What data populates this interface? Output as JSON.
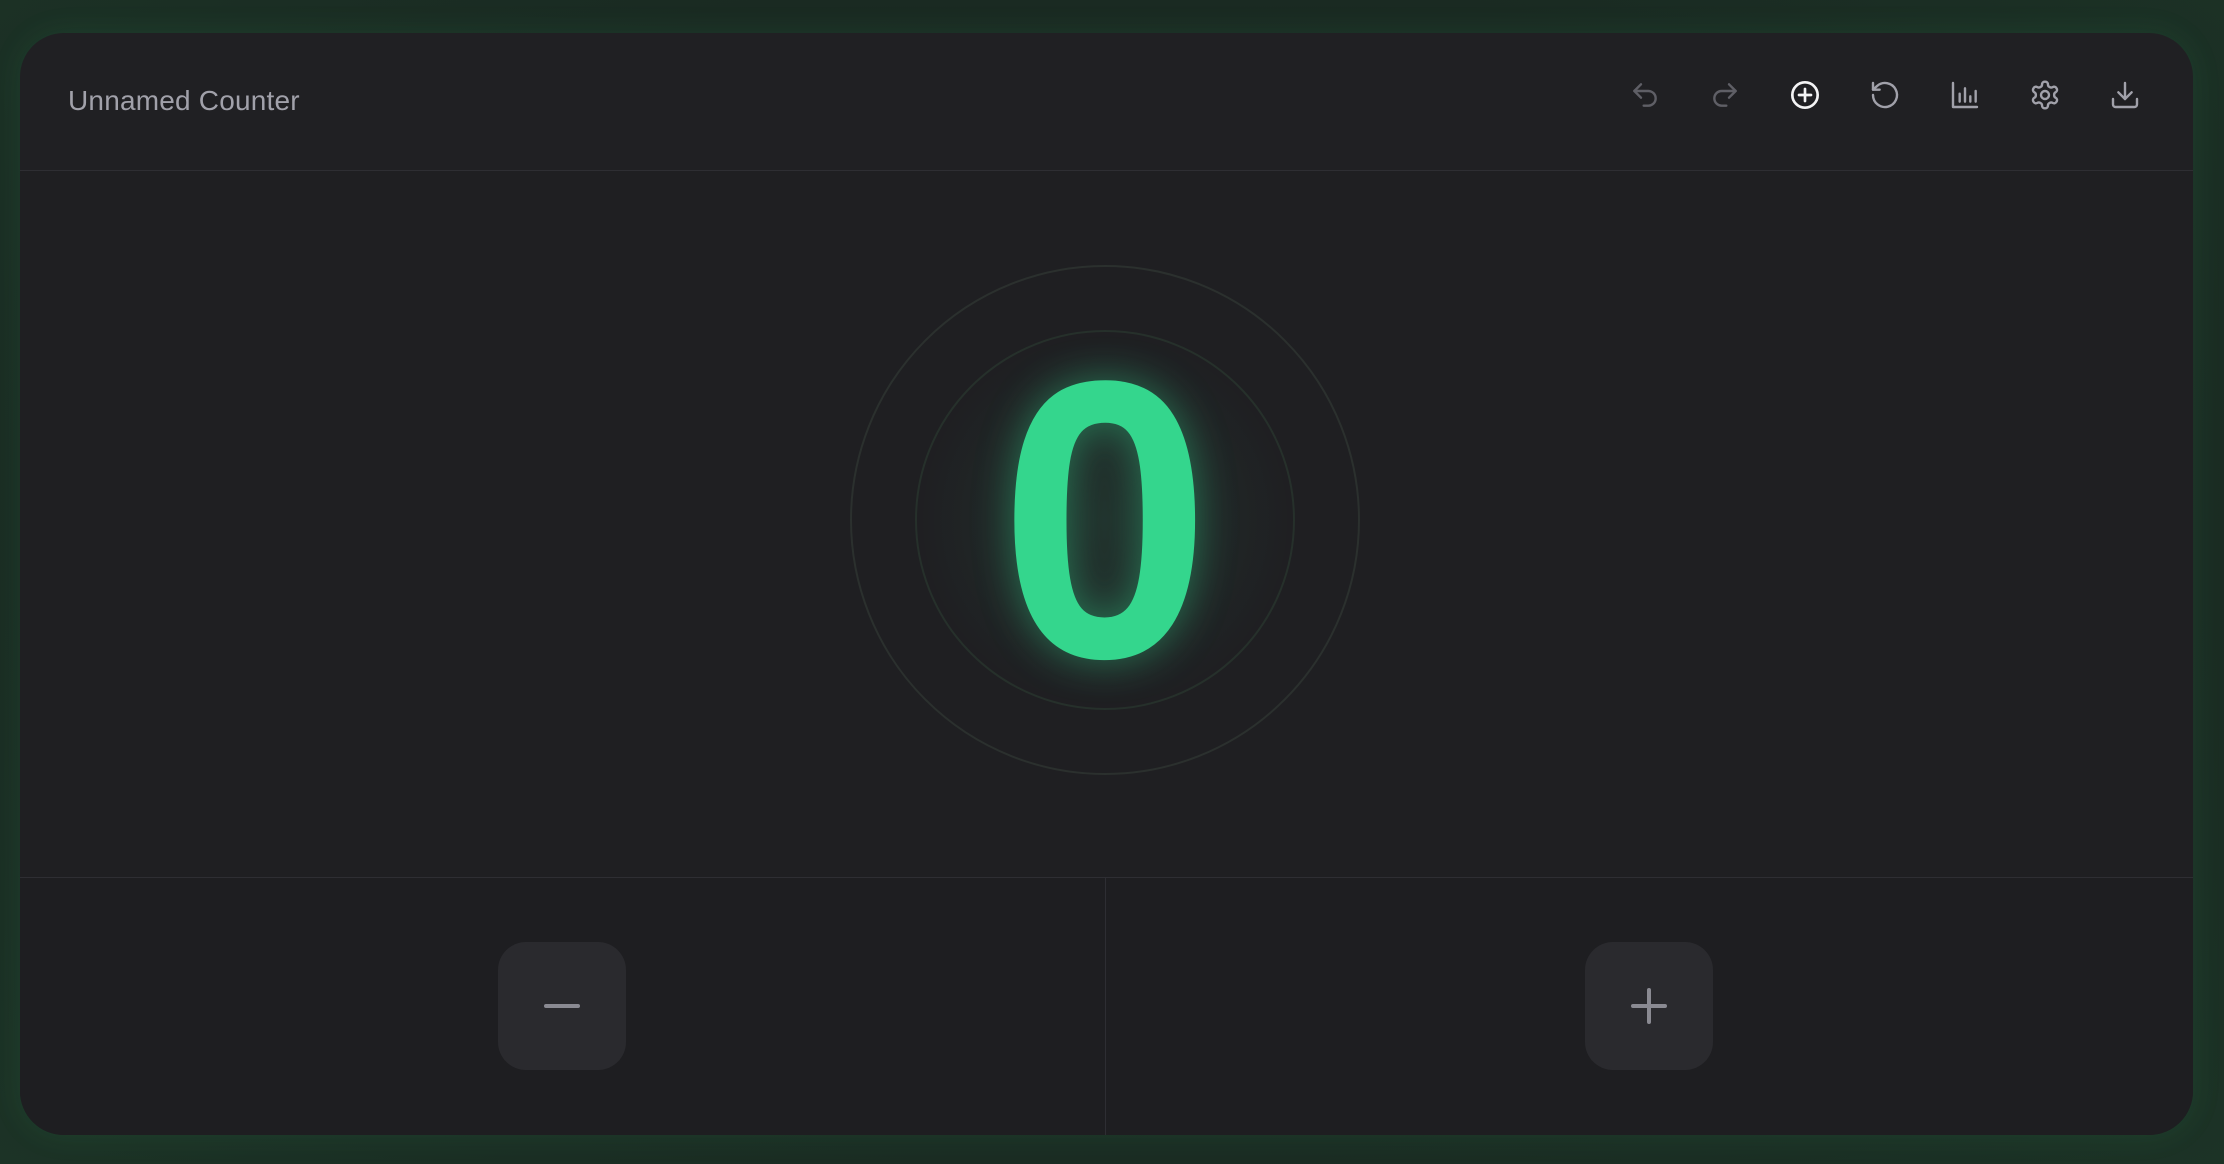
{
  "counter": {
    "name": "Unnamed Counter",
    "value": "0"
  },
  "toolbar": {
    "items": [
      {
        "icon": "undo-icon"
      },
      {
        "icon": "redo-icon"
      },
      {
        "icon": "add-circle-icon"
      },
      {
        "icon": "reset-icon"
      },
      {
        "icon": "bar-chart-icon"
      },
      {
        "icon": "gear-icon"
      },
      {
        "icon": "download-icon"
      }
    ]
  },
  "controls": {
    "decrement_icon": "minus-icon",
    "increment_icon": "plus-icon"
  },
  "colors": {
    "accent": "#34d68d",
    "card_bg": "#202023",
    "muted_text": "#a1a1aa",
    "icon_dim": "#6b6b72",
    "icon_active": "#f4f4f5"
  }
}
